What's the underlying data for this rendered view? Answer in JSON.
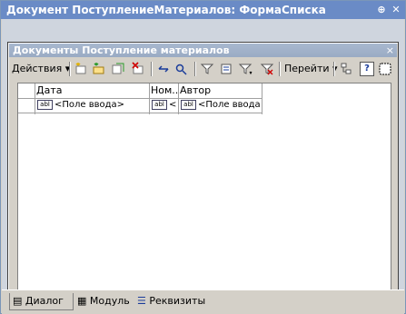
{
  "window": {
    "title": "Документ ПоступлениеМатериалов: ФормаСписка"
  },
  "form": {
    "title": "Документы Поступление материалов",
    "close_glyph": "×"
  },
  "toolbar": {
    "actions_label": "Действия",
    "goto_label": "Перейти",
    "help_label": "?"
  },
  "grid": {
    "columns": [
      {
        "header": "Дата",
        "cell": "<Поле ввода>"
      },
      {
        "header": "Ном...",
        "cell": "<"
      },
      {
        "header": "Автор",
        "cell": "<Поле ввода>"
      }
    ],
    "field_badge": "abl"
  },
  "bottom_tabs": [
    {
      "label": "Диалог"
    },
    {
      "label": "Модуль"
    },
    {
      "label": "Реквизиты"
    }
  ],
  "colors": {
    "titlebar": "#6a8bc6",
    "form_title": "#a8b8cf",
    "background": "#d4d0c8"
  }
}
